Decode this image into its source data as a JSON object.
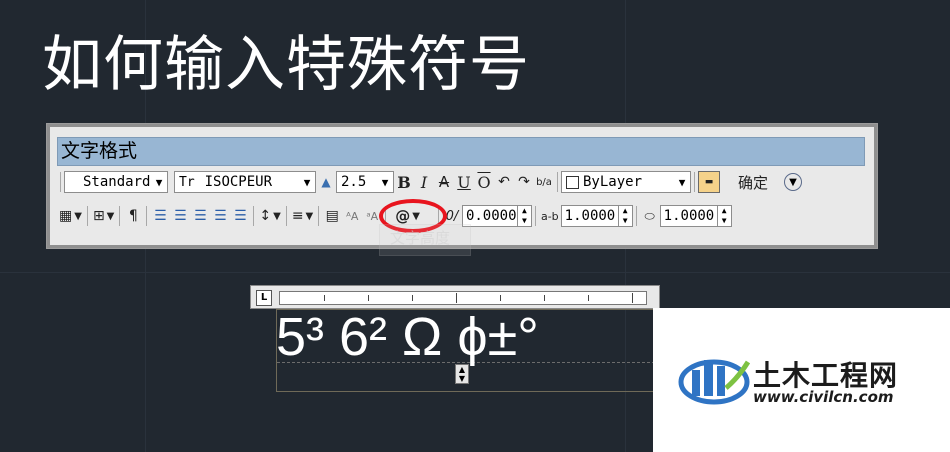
{
  "slide": {
    "title": "如何输入特殊符号"
  },
  "dialog": {
    "title": "文字格式",
    "row1": {
      "style_value": "Standard",
      "font_value": "ISOCPEUR",
      "height_value": "2.5",
      "bold": "B",
      "italic": "I",
      "strike": "A",
      "underline": "U",
      "overline": "O",
      "undo": "↶",
      "redo": "↷",
      "stack": "b/a",
      "color_value": "ByLayer",
      "ok_label": "确定"
    },
    "row2": {
      "symbol_label": "@",
      "oblique_value": "0.0000",
      "tracking_value": "1.0000",
      "width_factor_value": "1.0000"
    },
    "tooltip": "文字高度"
  },
  "editor": {
    "text": "5³ 6² Ω ϕ±°"
  },
  "watermark": {
    "name": "土木工程网",
    "url": "www.civilcn.com"
  }
}
